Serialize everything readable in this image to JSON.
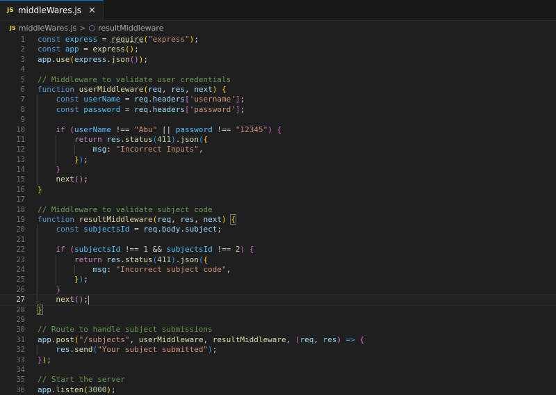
{
  "tab": {
    "badge": "JS",
    "filename": "middleWares.js",
    "close": "✕"
  },
  "breadcrumb": {
    "badge": "JS",
    "file": "middleWares.js",
    "separator": ">",
    "symbol_icon": "⬡",
    "symbol": "resultMiddleware"
  },
  "editor": {
    "current_line": 27,
    "lines": [
      {
        "n": "1",
        "indent": 0,
        "t": [
          [
            "kw",
            "const "
          ],
          [
            "cst",
            "express"
          ],
          [
            "pl",
            " = "
          ],
          [
            "fn squig",
            "require"
          ],
          [
            "p1",
            "("
          ],
          [
            "str",
            "\"express\""
          ],
          [
            "p1",
            ")"
          ],
          [
            "pl",
            ";"
          ]
        ]
      },
      {
        "n": "2",
        "indent": 0,
        "t": [
          [
            "kw",
            "const "
          ],
          [
            "cst",
            "app"
          ],
          [
            "pl",
            " = "
          ],
          [
            "fn",
            "express"
          ],
          [
            "p1",
            "()"
          ],
          [
            "pl",
            ";"
          ]
        ]
      },
      {
        "n": "3",
        "indent": 0,
        "t": [
          [
            "var",
            "app"
          ],
          [
            "pl",
            "."
          ],
          [
            "fn",
            "use"
          ],
          [
            "p1",
            "("
          ],
          [
            "var",
            "express"
          ],
          [
            "pl",
            "."
          ],
          [
            "fn",
            "json"
          ],
          [
            "p2",
            "()"
          ],
          [
            "p1",
            ")"
          ],
          [
            "pl",
            ";"
          ]
        ]
      },
      {
        "n": "4",
        "indent": 0,
        "t": []
      },
      {
        "n": "5",
        "indent": 0,
        "t": [
          [
            "cmt",
            "// Middleware to validate user credentials"
          ]
        ]
      },
      {
        "n": "6",
        "indent": 0,
        "t": [
          [
            "kw",
            "function "
          ],
          [
            "fn",
            "userMiddleware"
          ],
          [
            "p1",
            "("
          ],
          [
            "var",
            "req"
          ],
          [
            "pl",
            ", "
          ],
          [
            "var",
            "res"
          ],
          [
            "pl",
            ", "
          ],
          [
            "var",
            "next"
          ],
          [
            "p1",
            ")"
          ],
          [
            "pl",
            " "
          ],
          [
            "p1",
            "{"
          ]
        ]
      },
      {
        "n": "7",
        "indent": 1,
        "t": [
          [
            "pl",
            "    "
          ],
          [
            "kw",
            "const "
          ],
          [
            "cst",
            "userName"
          ],
          [
            "pl",
            " = "
          ],
          [
            "var",
            "req"
          ],
          [
            "pl",
            "."
          ],
          [
            "var",
            "headers"
          ],
          [
            "p2",
            "["
          ],
          [
            "str",
            "'username'"
          ],
          [
            "p2",
            "]"
          ],
          [
            "pl",
            ";"
          ]
        ]
      },
      {
        "n": "8",
        "indent": 1,
        "t": [
          [
            "pl",
            "    "
          ],
          [
            "kw",
            "const "
          ],
          [
            "cst",
            "password"
          ],
          [
            "pl",
            " = "
          ],
          [
            "var",
            "req"
          ],
          [
            "pl",
            "."
          ],
          [
            "var",
            "headers"
          ],
          [
            "p2",
            "["
          ],
          [
            "str",
            "'password'"
          ],
          [
            "p2",
            "]"
          ],
          [
            "pl",
            ";"
          ]
        ]
      },
      {
        "n": "9",
        "indent": 1,
        "t": []
      },
      {
        "n": "10",
        "indent": 1,
        "t": [
          [
            "pl",
            "    "
          ],
          [
            "ctl",
            "if "
          ],
          [
            "p2",
            "("
          ],
          [
            "cst",
            "userName"
          ],
          [
            "pl",
            " !== "
          ],
          [
            "str",
            "\"Abu\""
          ],
          [
            "pl",
            " || "
          ],
          [
            "cst",
            "password"
          ],
          [
            "pl",
            " !== "
          ],
          [
            "str",
            "\"12345\""
          ],
          [
            "p2",
            ")"
          ],
          [
            "pl",
            " "
          ],
          [
            "p2",
            "{"
          ]
        ]
      },
      {
        "n": "11",
        "indent": 2,
        "t": [
          [
            "pl",
            "        "
          ],
          [
            "ctl",
            "return "
          ],
          [
            "var",
            "res"
          ],
          [
            "pl",
            "."
          ],
          [
            "fn",
            "status"
          ],
          [
            "p3",
            "("
          ],
          [
            "num",
            "411"
          ],
          [
            "p3",
            ")"
          ],
          [
            "pl",
            "."
          ],
          [
            "fn",
            "json"
          ],
          [
            "p3",
            "("
          ],
          [
            "p1",
            "{"
          ]
        ]
      },
      {
        "n": "12",
        "indent": 3,
        "t": [
          [
            "pl",
            "            "
          ],
          [
            "var",
            "msg"
          ],
          [
            "pl",
            ": "
          ],
          [
            "str",
            "\"Incorrect Inputs\""
          ],
          [
            "pl",
            ","
          ]
        ]
      },
      {
        "n": "13",
        "indent": 2,
        "t": [
          [
            "pl",
            "        "
          ],
          [
            "p1",
            "}"
          ],
          [
            "p3",
            ")"
          ],
          [
            "pl",
            ";"
          ]
        ]
      },
      {
        "n": "14",
        "indent": 1,
        "t": [
          [
            "pl",
            "    "
          ],
          [
            "p2",
            "}"
          ]
        ]
      },
      {
        "n": "15",
        "indent": 1,
        "t": [
          [
            "pl",
            "    "
          ],
          [
            "fn",
            "next"
          ],
          [
            "p2",
            "()"
          ],
          [
            "pl",
            ";"
          ]
        ]
      },
      {
        "n": "16",
        "indent": 0,
        "t": [
          [
            "p1",
            "}"
          ]
        ]
      },
      {
        "n": "17",
        "indent": 0,
        "t": []
      },
      {
        "n": "18",
        "indent": 0,
        "t": [
          [
            "cmt",
            "// Middleware to validate subject code"
          ]
        ]
      },
      {
        "n": "19",
        "indent": 0,
        "t": [
          [
            "kw",
            "function "
          ],
          [
            "fn",
            "resultMiddleware"
          ],
          [
            "p1",
            "("
          ],
          [
            "var",
            "req"
          ],
          [
            "pl",
            ", "
          ],
          [
            "var",
            "res"
          ],
          [
            "pl",
            ", "
          ],
          [
            "var",
            "next"
          ],
          [
            "p1",
            ")"
          ],
          [
            "pl",
            " "
          ],
          [
            "p1 bm",
            "{"
          ]
        ]
      },
      {
        "n": "20",
        "indent": 1,
        "t": [
          [
            "pl",
            "    "
          ],
          [
            "kw",
            "const "
          ],
          [
            "cst",
            "subjectsId"
          ],
          [
            "pl",
            " = "
          ],
          [
            "var",
            "req"
          ],
          [
            "pl",
            "."
          ],
          [
            "var",
            "body"
          ],
          [
            "pl",
            "."
          ],
          [
            "var",
            "subject"
          ],
          [
            "pl",
            ";"
          ]
        ]
      },
      {
        "n": "21",
        "indent": 1,
        "t": []
      },
      {
        "n": "22",
        "indent": 1,
        "t": [
          [
            "pl",
            "    "
          ],
          [
            "ctl",
            "if "
          ],
          [
            "p2",
            "("
          ],
          [
            "cst",
            "subjectsId"
          ],
          [
            "pl",
            " !== "
          ],
          [
            "num",
            "1"
          ],
          [
            "pl",
            " && "
          ],
          [
            "cst",
            "subjectsId"
          ],
          [
            "pl",
            " !== "
          ],
          [
            "num",
            "2"
          ],
          [
            "p2",
            ")"
          ],
          [
            "pl",
            " "
          ],
          [
            "p2",
            "{"
          ]
        ]
      },
      {
        "n": "23",
        "indent": 2,
        "t": [
          [
            "pl",
            "        "
          ],
          [
            "ctl",
            "return "
          ],
          [
            "var",
            "res"
          ],
          [
            "pl",
            "."
          ],
          [
            "fn",
            "status"
          ],
          [
            "p3",
            "("
          ],
          [
            "num",
            "411"
          ],
          [
            "p3",
            ")"
          ],
          [
            "pl",
            "."
          ],
          [
            "fn",
            "json"
          ],
          [
            "p3",
            "("
          ],
          [
            "p1",
            "{"
          ]
        ]
      },
      {
        "n": "24",
        "indent": 3,
        "t": [
          [
            "pl",
            "            "
          ],
          [
            "var",
            "msg"
          ],
          [
            "pl",
            ": "
          ],
          [
            "str",
            "\"Incorrect subject code\""
          ],
          [
            "pl",
            ","
          ]
        ]
      },
      {
        "n": "25",
        "indent": 2,
        "t": [
          [
            "pl",
            "        "
          ],
          [
            "p1",
            "}"
          ],
          [
            "p3",
            ")"
          ],
          [
            "pl",
            ";"
          ]
        ]
      },
      {
        "n": "26",
        "indent": 1,
        "t": [
          [
            "pl",
            "    "
          ],
          [
            "p2",
            "}"
          ]
        ]
      },
      {
        "n": "27",
        "indent": 1,
        "cursor": true,
        "t": [
          [
            "pl",
            "    "
          ],
          [
            "fn",
            "next"
          ],
          [
            "p2",
            "()"
          ],
          [
            "pl",
            ";"
          ]
        ]
      },
      {
        "n": "28",
        "indent": 0,
        "t": [
          [
            "p1 bm",
            "}"
          ]
        ]
      },
      {
        "n": "29",
        "indent": 0,
        "t": []
      },
      {
        "n": "30",
        "indent": 0,
        "t": [
          [
            "cmt",
            "// Route to handle subject submissions"
          ]
        ]
      },
      {
        "n": "31",
        "indent": 0,
        "t": [
          [
            "var",
            "app"
          ],
          [
            "pl",
            "."
          ],
          [
            "fn",
            "post"
          ],
          [
            "p1",
            "("
          ],
          [
            "str",
            "\"/subjects\""
          ],
          [
            "pl",
            ", "
          ],
          [
            "fn",
            "userMiddleware"
          ],
          [
            "pl",
            ", "
          ],
          [
            "fn",
            "resultMiddleware"
          ],
          [
            "pl",
            ", "
          ],
          [
            "p2",
            "("
          ],
          [
            "var",
            "req"
          ],
          [
            "pl",
            ", "
          ],
          [
            "var",
            "res"
          ],
          [
            "p2",
            ")"
          ],
          [
            "pl",
            " "
          ],
          [
            "kw",
            "=>"
          ],
          [
            "pl",
            " "
          ],
          [
            "p2",
            "{"
          ]
        ]
      },
      {
        "n": "32",
        "indent": 1,
        "t": [
          [
            "pl",
            "    "
          ],
          [
            "var",
            "res"
          ],
          [
            "pl",
            "."
          ],
          [
            "fn",
            "send"
          ],
          [
            "p3",
            "("
          ],
          [
            "str",
            "\"Your subject submitted\""
          ],
          [
            "p3",
            ")"
          ],
          [
            "pl",
            ";"
          ]
        ]
      },
      {
        "n": "33",
        "indent": 0,
        "t": [
          [
            "p2",
            "}"
          ],
          [
            "p1",
            ")"
          ],
          [
            "pl",
            ";"
          ]
        ]
      },
      {
        "n": "34",
        "indent": 0,
        "t": []
      },
      {
        "n": "35",
        "indent": 0,
        "t": [
          [
            "cmt",
            "// Start the server"
          ]
        ]
      },
      {
        "n": "36",
        "indent": 0,
        "t": [
          [
            "var",
            "app"
          ],
          [
            "pl",
            "."
          ],
          [
            "fn",
            "listen"
          ],
          [
            "p1",
            "("
          ],
          [
            "num",
            "3000"
          ],
          [
            "p1",
            ")"
          ],
          [
            "pl",
            ";"
          ]
        ]
      }
    ]
  }
}
